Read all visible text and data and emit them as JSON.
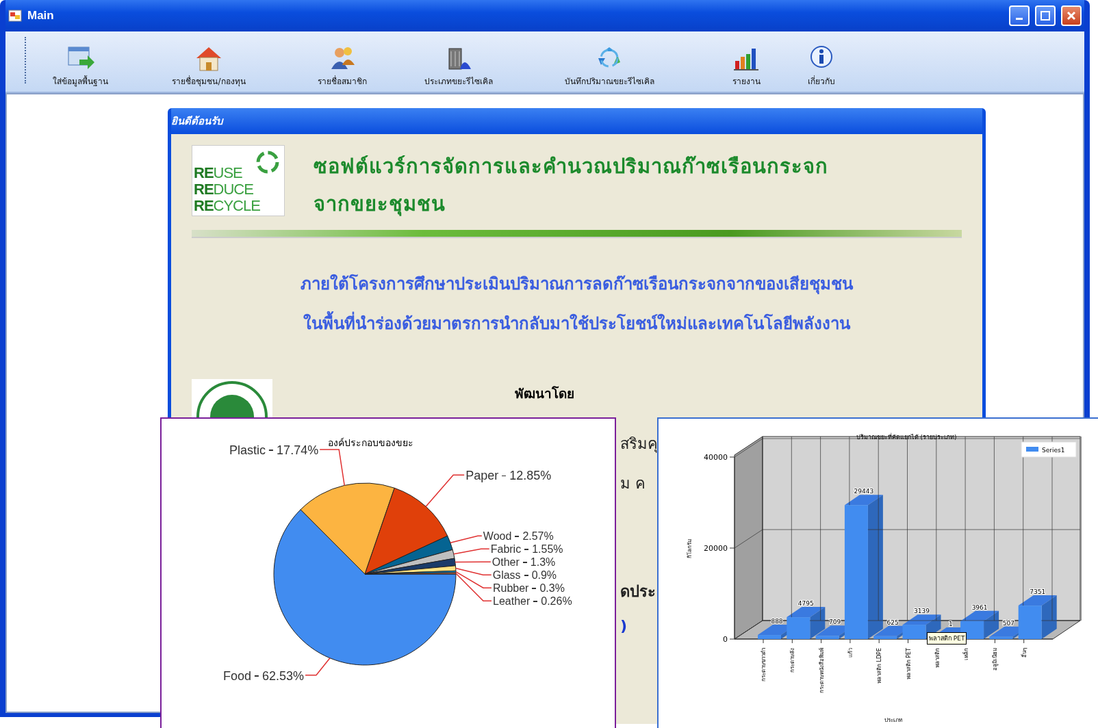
{
  "window": {
    "title": "Main"
  },
  "toolbar": [
    {
      "label": "ใส่ข้อมูลพื้นฐาน"
    },
    {
      "label": "รายชื่อชุมชน/กองทุน"
    },
    {
      "label": "รายชื่อสมาชิก"
    },
    {
      "label": "ประเภทขยะรีไซเคิล"
    },
    {
      "label": "บันทึกปริมาณขยะรีไซเคิล"
    },
    {
      "label": "รายงาน"
    },
    {
      "label": "เกี่ยวกับ"
    }
  ],
  "welcome_window": {
    "title": "ยินดีต้อนรับ",
    "logo_lines": [
      "**RE**USE",
      "**RE**DUCE",
      "**RE**CYCLE"
    ],
    "heading": [
      "ซอฟต์แวร์การจัดการและคำนวณปริมาณก๊าซเรือนกระจก",
      "จากขยะชุมชน"
    ],
    "subtitle": [
      "ภายใต้โครงการศึกษาประเมินปริมาณการลดก๊าซเรือนกระจกจากของเสียชุมชน",
      "ในพื้นที่นำร่องด้วยมาตรการนำกลับมาใช้ประโยชน์ใหม่และเทคโนโลยีพลังงาน"
    ],
    "developed_by": "พัฒนาโดย",
    "partial_texts": [
      {
        "text": "สริมคุ",
        "kind": "plain"
      },
      {
        "text": "ม ค",
        "kind": "plain"
      },
      {
        "text": "ดประ",
        "kind": "bold"
      },
      {
        "text": ")",
        "kind": "link"
      }
    ]
  },
  "pie_window": {
    "chart_data": {
      "type": "pie",
      "title": "องค์ประกอบของขยะ",
      "categories": [
        "Food",
        "Plastic",
        "Paper",
        "Wood",
        "Fabric",
        "Other",
        "Glass",
        "Rubber",
        "Leather"
      ],
      "values": [
        62.53,
        17.74,
        12.85,
        2.57,
        1.55,
        1.3,
        0.9,
        0.3,
        0.26
      ],
      "value_labels": [
        "62.53%",
        "17.74%",
        "12.85%",
        "2.57%",
        "1.55%",
        "1.3%",
        "0.9%",
        "0.3%",
        "0.26%"
      ]
    }
  },
  "bar_window": {
    "chart_data": {
      "type": "bar",
      "title": "ปริมาณขยะที่คัดแยกได้ (รายประเภท)",
      "xlabel": "ประเภท",
      "ylabel": "กิโลกรัม",
      "categories": [
        "กระดาษขาวดำ",
        "กระดาษลัง",
        "กระดาษหนังสือพิมพ์",
        "แก้ว",
        "พลาสติก LDPE",
        "พลาสติก PET",
        "พลาสติก",
        "เหล็ก",
        "อลูมิเนียม",
        "อื่นๆ"
      ],
      "series": [
        {
          "name": "Series1",
          "color": "#418cf0",
          "values": [
            888,
            4795,
            709,
            29443,
            625,
            3139,
            1,
            3961,
            507,
            7351
          ]
        }
      ],
      "ylim": [
        0,
        40000
      ],
      "yticks": [
        0,
        20000,
        40000
      ],
      "data_labels": true,
      "grid": true
    },
    "tooltip": "พลาสติก PET"
  }
}
